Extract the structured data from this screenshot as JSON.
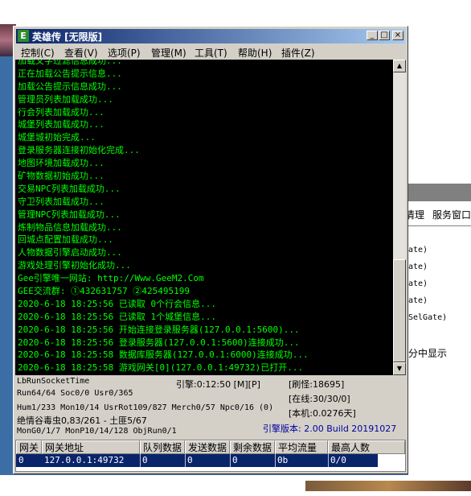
{
  "window": {
    "icon": "E",
    "title": "英雄传 [无限版]",
    "min_label": "_",
    "max_label": "□",
    "close_label": "×"
  },
  "menu": [
    "控制(C)",
    "查看(V)",
    "选项(P)",
    "管理(M)",
    "工具(T)",
    "帮助(H)",
    "插件(Z)"
  ],
  "console": {
    "line_color": "#00ff00",
    "lines": [
      "加载文字过滤信息成功...",
      "正在加载公告提示信息...",
      "加载公告提示信息成功...",
      "管理员列表加载成功...",
      "行会列表加载成功...",
      "城堡列表加载成功...",
      "城堡城初始完成...",
      "登录服务器连接初始化完成...",
      "地图环境加载成功...",
      "矿物数据初始成功...",
      "交易NPC列表加载成功...",
      "守卫列表加载成功...",
      "管理NPC列表加载成功...",
      "炼制物品信息加载成功...",
      "回城点配置加载成功...",
      "人物数据引擎启动成功...",
      "游戏处理引擎初始化成功...",
      "Gee引擎唯一网站: http://Www.GeeM2.Com",
      "GEE交流群: ①432631757   ②425495199",
      "2020-6-18 18:25:56 已读取 0个行会信息...",
      "2020-6-18 18:25:56 已读取 1个城堡信息...",
      "2020-6-18 18:25:56 开始连接登录服务器(127.0.0.1:5600)...",
      "2020-6-18 18:25:56 登录服务器(127.0.0.1:5600)连接成功...",
      "2020-6-18 18:25:58 数据库服务器(127.0.0.1:6000)连接成功...",
      "2020-6-18 18:25:58 游戏网关[0](127.0.0.1:49732)已打开..."
    ]
  },
  "status": {
    "socket_time": "LbRunSocketTime",
    "run": "Run64/64 Soc0/0 Usr0/365",
    "hum": "Hum1/233 Mon10/14 UsrRot109/827 Merch0/57 Npc0/16 (0)",
    "monster": "绝情谷毒虫0,83/261 - 土匪5/67",
    "mon": "MonG0/1/7 MonP10/14/128 ObjRun0/1",
    "engine_time": "引擎:0:12:50 [M][P]",
    "refresh": "[刷怪:18695]",
    "online": "[在线:30/30/0]",
    "local": "[本机:0.0276天]",
    "version": "引擎版本: 2.00 Build 20191027"
  },
  "table": {
    "headers": [
      "网关",
      "网关地址",
      "队列数据",
      "发送数据",
      "剩余数据",
      "平均流量",
      "最高人数"
    ],
    "rows": [
      [
        "0",
        "127.0.0.1:49732",
        "0",
        "0",
        "0",
        "0b",
        "0/0"
      ]
    ]
  },
  "background_window": {
    "tab1": "清理",
    "tab2": "服务窗口",
    "lines": [
      "ate)",
      "ate)",
      "ate)",
      "ate)",
      "SelGate)"
    ],
    "footer": "分中显示"
  }
}
